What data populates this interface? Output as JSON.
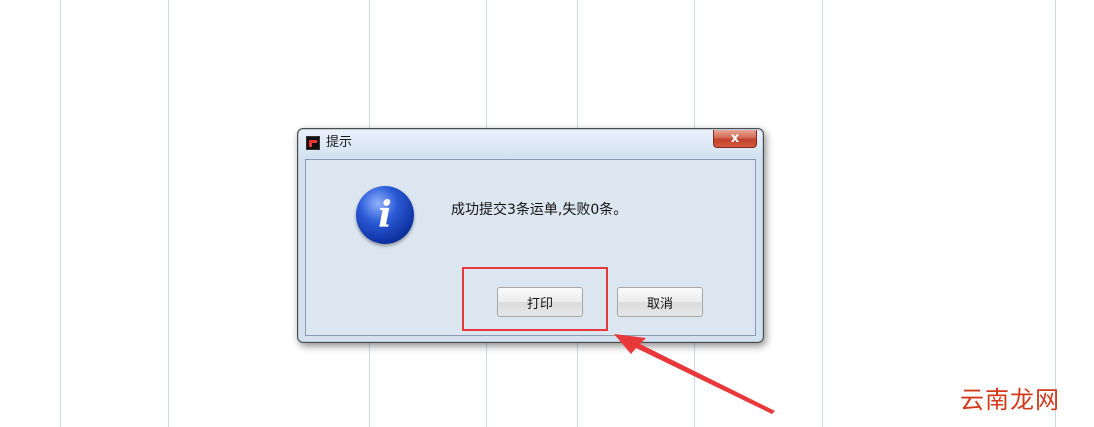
{
  "dialog": {
    "title": "提示",
    "close_glyph": "x",
    "message": "成功提交3条运单,失败0条。",
    "icon": "info-icon",
    "buttons": {
      "print_label": "打印",
      "cancel_label": "取消"
    }
  },
  "annotation": {
    "highlight_color": "#e8383a",
    "target": "print-button"
  },
  "watermark": {
    "text": "云南龙网"
  },
  "colors": {
    "dialog_bg": "#d3e1f1",
    "close_button": "#c2402a",
    "info_icon": "#0d2f9e"
  }
}
